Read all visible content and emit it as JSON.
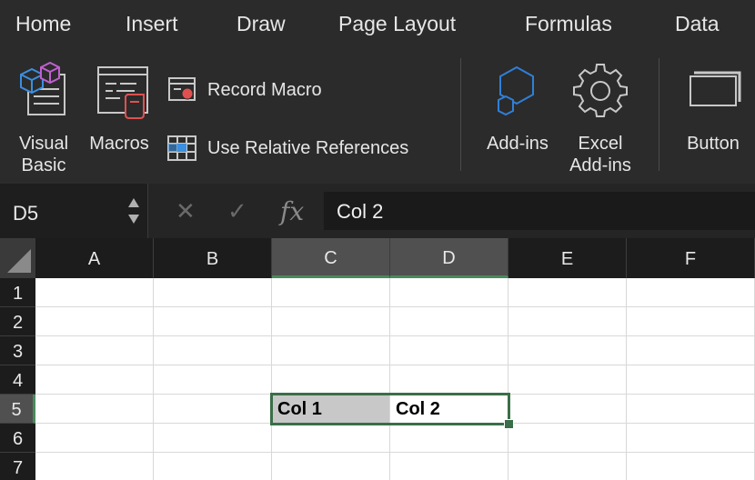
{
  "tabs": [
    "Home",
    "Insert",
    "Draw",
    "Page Layout",
    "Formulas",
    "Data"
  ],
  "ribbon": {
    "visual_basic": "Visual Basic",
    "macros": "Macros",
    "record_macro": "Record Macro",
    "use_relative": "Use Relative References",
    "addins": "Add-ins",
    "excel_addins": "Excel Add-ins",
    "button": "Button",
    "visual_basic_l1": "Visual",
    "visual_basic_l2": "Basic",
    "excel_addins_l1": "Excel",
    "excel_addins_l2": "Add-ins"
  },
  "formula_bar": {
    "name_box": "D5",
    "cancel_icon": "✕",
    "enter_icon": "✓",
    "fx": "fx",
    "content": "Col 2"
  },
  "grid": {
    "columns": [
      "A",
      "B",
      "C",
      "D",
      "E",
      "F"
    ],
    "rows": [
      "1",
      "2",
      "3",
      "4",
      "5",
      "6",
      "7"
    ],
    "selected_columns": [
      "C",
      "D"
    ],
    "selected_row": "5",
    "cells": {
      "C5": "Col 1",
      "D5": "Col 2"
    },
    "highlight_cell": "C5"
  },
  "colors": {
    "accent_green": "#3a6e48",
    "addins_blue": "#2f7fd8"
  }
}
